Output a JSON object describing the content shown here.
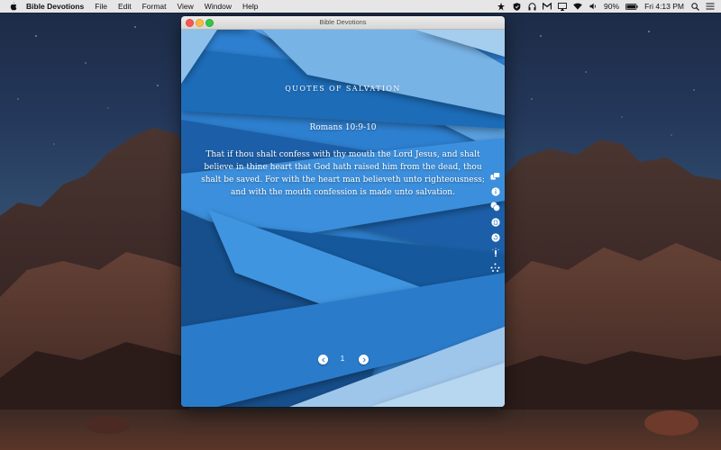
{
  "menubar": {
    "app_name": "Bible Devotions",
    "menus": [
      "File",
      "Edit",
      "Format",
      "View",
      "Window",
      "Help"
    ],
    "battery": "90%",
    "clock": "Fri 4:13 PM",
    "tray_icons": [
      "app-status-icon",
      "shield-icon",
      "headphones-icon",
      "mail-icon",
      "airplay-icon",
      "wifi-icon",
      "volume-icon",
      "battery-icon",
      "spotlight-icon",
      "list-icon"
    ]
  },
  "window": {
    "title": "Bible Devotions",
    "section_title": "QUOTES OF SALVATION",
    "verse_reference": "Romans 10:9-10",
    "verse_text": "That if thou shalt confess with thy mouth the Lord Jesus, and shalt believe in thine heart that God hath raised him from the dead, thou shalt be saved. For with the heart man believeth unto righteousness; and with the mouth confession is made unto salvation.",
    "side_tools": [
      "share-icon",
      "info-icon",
      "chat-icon",
      "copy-icon",
      "reload-icon",
      "bulb-icon",
      "sparkle-icon"
    ],
    "page_number": "1"
  },
  "colors": {
    "accent_blue": "#2d7fd0",
    "dark_blue": "#124f8c",
    "light_blue": "#9ec6ea"
  }
}
